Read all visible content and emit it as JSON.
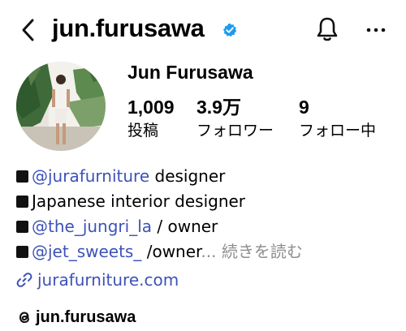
{
  "header": {
    "username": "jun.furusawa",
    "back_icon": "chevron-left-icon",
    "verified_icon": "verified-badge-icon",
    "bell_icon": "bell-icon",
    "more_icon": "more-horizontal-icon"
  },
  "profile": {
    "display_name": "Jun Furusawa",
    "stats": [
      {
        "value": "1,009",
        "label": "投稿"
      },
      {
        "value": "3.9万",
        "label": "フォロワー"
      },
      {
        "value": "9",
        "label": "フォロー中"
      }
    ]
  },
  "bio": {
    "line1": {
      "mention": "@jurafurniture",
      "text": " designer"
    },
    "line2": {
      "text": "Japanese interior designer"
    },
    "line3": {
      "mention": "@the_jungri_la",
      "text": " / owner"
    },
    "line4": {
      "mention": "@jet_sweets_",
      "text": " /owner",
      "ellipsis": "...",
      "more_label": " 続きを読む"
    }
  },
  "website": {
    "url": "jurafurniture.com",
    "icon": "link-icon"
  },
  "threads": {
    "handle": "jun.furusawa",
    "icon": "threads-icon"
  },
  "colors": {
    "link": "#3d52b8",
    "verified": "#1d9bf0",
    "muted": "#8e8e8e"
  }
}
